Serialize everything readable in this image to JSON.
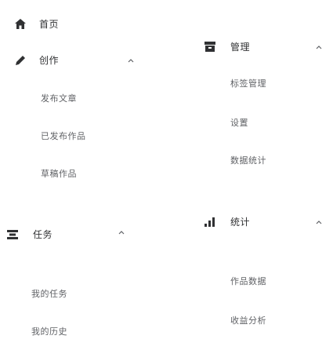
{
  "left_menu": {
    "home": {
      "label": "首页",
      "icon": "home-icon"
    },
    "group1": {
      "label": "创作",
      "icon": "pen-icon",
      "arrow": "chevron-up-icon",
      "items": [
        "发布文章",
        "已发布作品",
        "草稿作品"
      ]
    },
    "group2": {
      "label": "任务",
      "icon": "list-icon",
      "arrow": "chevron-up-icon",
      "items": [
        "我的任务",
        "我的历史"
      ]
    }
  },
  "right_menu": {
    "group1": {
      "label": "管理",
      "icon": "grid-icon",
      "arrow": "chevron-up-icon",
      "items": [
        "标签管理",
        "设置",
        "数据统计"
      ]
    },
    "group2": {
      "label": "统计",
      "icon": "bar-chart-icon",
      "arrow": "chevron-up-icon",
      "items": [
        "作品数据",
        "收益分析"
      ]
    }
  }
}
